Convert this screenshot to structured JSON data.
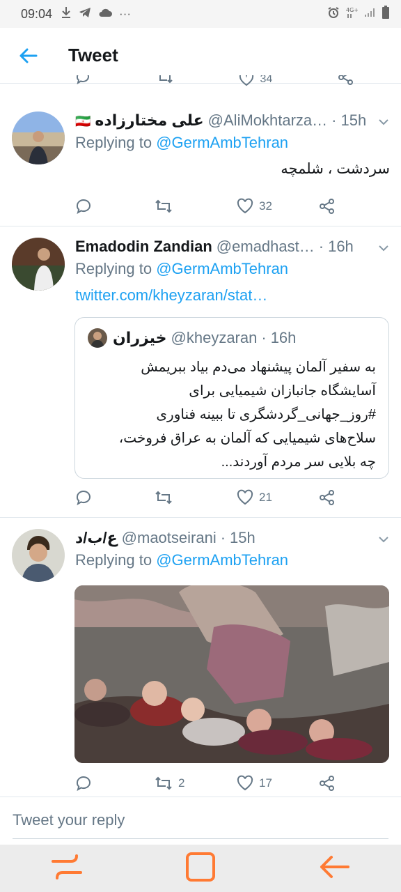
{
  "status_bar": {
    "time": "09:04",
    "more": "···"
  },
  "header": {
    "title": "Tweet"
  },
  "previous_actions": {
    "like_count": "34"
  },
  "tweets": [
    {
      "name": "علی مختارزاده",
      "flag": "🇮🇷",
      "handle": "@AliMokhtarza…",
      "age": "15h",
      "replying_prefix": "Replying to",
      "replying_to": "@GermAmbTehran",
      "text": "سردشت ، شلمچه",
      "likes": "32"
    },
    {
      "name": "Emadodin Zandian",
      "handle": "@emadhast…",
      "age": "16h",
      "replying_prefix": "Replying to",
      "replying_to": "@GermAmbTehran",
      "link": "twitter.com/kheyzaran/stat…",
      "likes": "21",
      "quote": {
        "name": "خیزران",
        "handle": "@kheyzaran",
        "age": "16h",
        "lines": [
          "به سفیر آلمان پیشنهاد می‌دم بیاد ببریمش",
          "آسایشگاه جانبازان شیمیایی برای",
          "#روز_جهانی_گردشگری تا ببینه فناوری",
          "سلاح‌های شیمیایی که آلمان به عراق فروخت،",
          "چه بلایی سر مردم آوردند..."
        ]
      }
    },
    {
      "name": "ع/ب/د",
      "handle": "@maotseirani",
      "age": "15h",
      "replying_prefix": "Replying to",
      "replying_to": "@GermAmbTehran",
      "retweets": "2",
      "likes": "17"
    }
  ],
  "reply_box": {
    "placeholder": "Tweet your reply"
  },
  "colors": {
    "link": "#1da1f2",
    "secondary": "#657786",
    "nav_accent": "#ff7a33"
  }
}
